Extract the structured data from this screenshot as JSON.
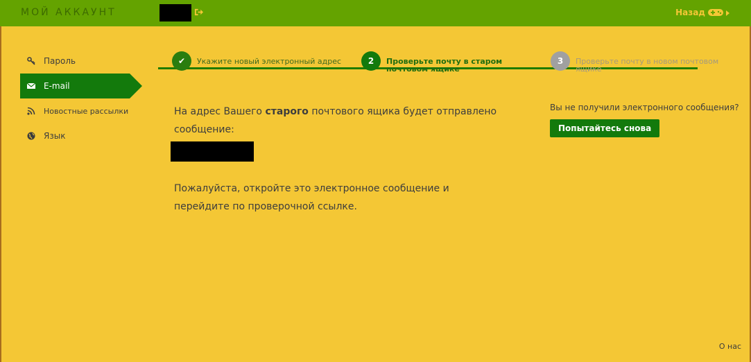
{
  "header": {
    "brand": "МОЙ АККАУНТ",
    "logout_icon": "sign-out-icon",
    "back_label": "Назад",
    "back_icon": "gamepad-icon"
  },
  "sidebar": {
    "items": [
      {
        "label": "Пароль",
        "icon": "key-icon",
        "active": false
      },
      {
        "label": "E-mail",
        "icon": "envelope-icon",
        "active": true
      },
      {
        "label": "Новостные рассылки",
        "icon": "rss-icon",
        "active": false
      },
      {
        "label": "Язык",
        "icon": "globe-icon",
        "active": false
      }
    ]
  },
  "stepper": {
    "steps": [
      {
        "marker": "✔",
        "label": "Укажите новый электронный адрес",
        "state": "done"
      },
      {
        "marker": "2",
        "label": "Проверьте почту в старом почтовом ящике",
        "state": "current"
      },
      {
        "marker": "3",
        "label": "Проверьте почту в новом почтовом ящике",
        "state": "pending"
      }
    ]
  },
  "main": {
    "line1_pre": "На адрес Вашего ",
    "line1_bold": "старого",
    "line1_post": " почтового ящика будет отправлено сообщение:",
    "instruction": "Пожалуйста, откройте это электронное сообщение и перейдите по проверочной ссылке."
  },
  "resend": {
    "question": "Вы не получили электронного сообщения?",
    "button_label": "Попытайтесь снова"
  },
  "footer": {
    "about_label": "О нас"
  },
  "colors": {
    "topbar": "#64a300",
    "background": "#f4c735",
    "accent_green": "#137a0c",
    "pending_gray": "#a0a0a0"
  }
}
